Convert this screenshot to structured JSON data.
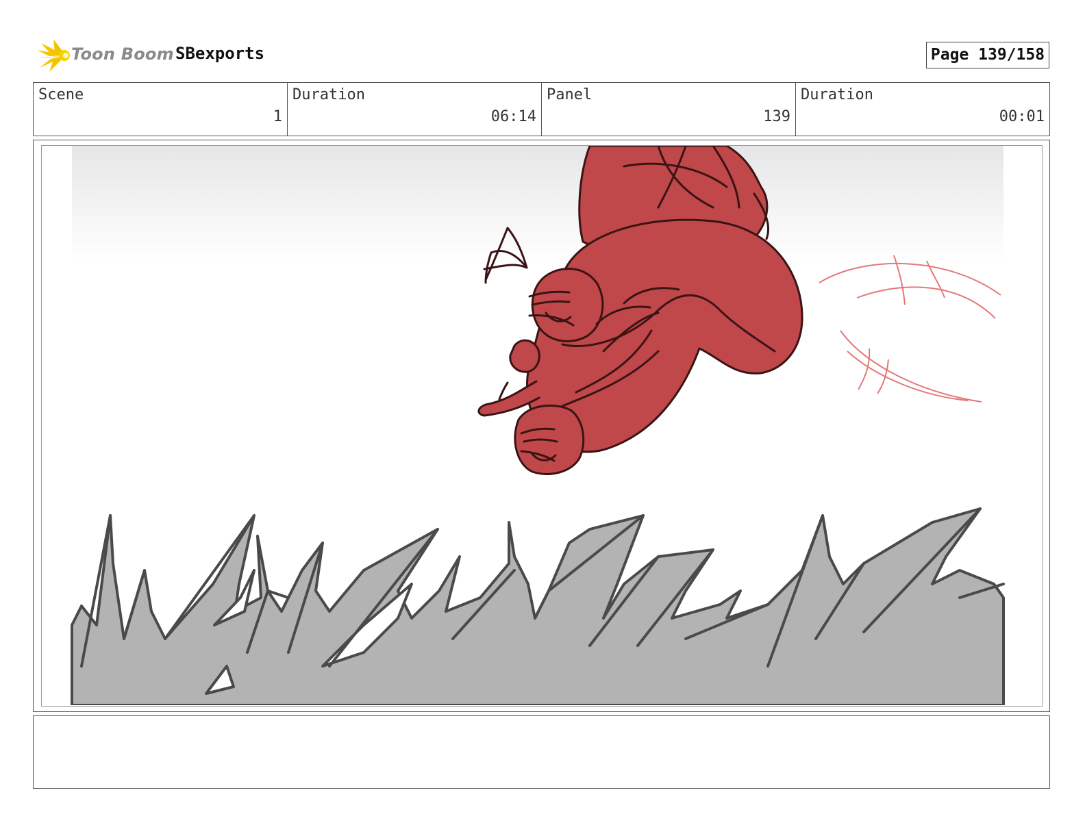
{
  "header": {
    "logo_text": "Toon Boom",
    "project_name": "SBexports",
    "page_label": "Page 139/158"
  },
  "info": {
    "scene_label": "Scene",
    "scene_value": "1",
    "scene_duration_label": "Duration",
    "scene_duration_value": "06:14",
    "panel_label": "Panel",
    "panel_value": "139",
    "panel_duration_label": "Duration",
    "panel_duration_value": "00:01"
  },
  "notes": {
    "text": ""
  },
  "colors": {
    "character_fill": "#c0474a",
    "character_line": "#3a1414",
    "grass_fill": "#b3b3b3",
    "grass_line": "#4a4a4a",
    "motion_lines": "#e06060",
    "logo_accent": "#f5c400"
  }
}
